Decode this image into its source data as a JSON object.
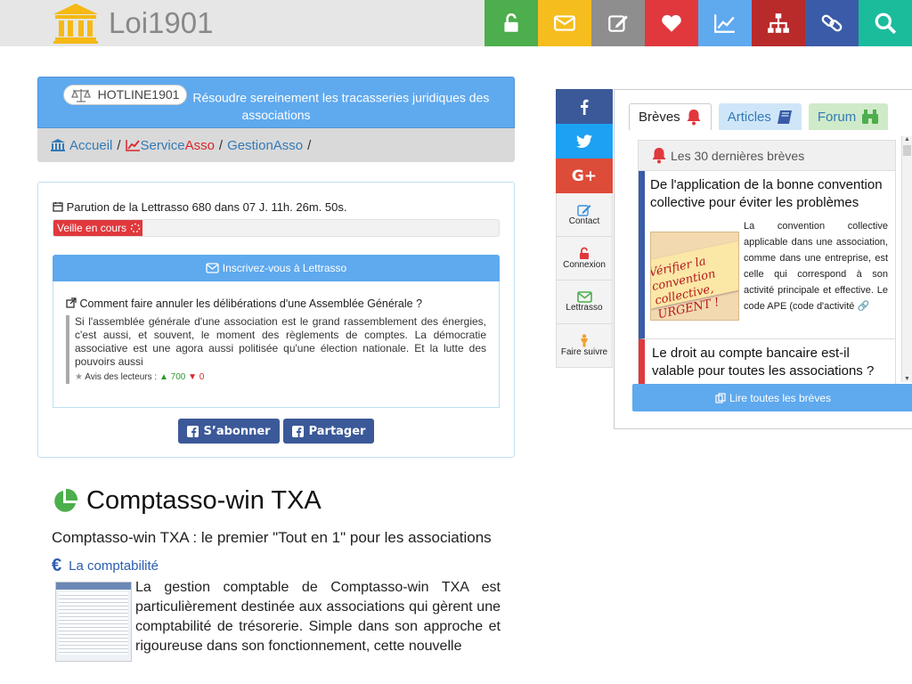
{
  "header": {
    "site_name": "Loi1901",
    "nav": [
      {
        "name": "login-nav-button",
        "icon": "unlock-icon",
        "color": "#4cae4c"
      },
      {
        "name": "mail-nav-button",
        "icon": "envelope-icon",
        "color": "#f5bd1e"
      },
      {
        "name": "edit-nav-button",
        "icon": "edit-icon",
        "color": "#8e8e8e"
      },
      {
        "name": "favorites-nav-button",
        "icon": "heart-icon",
        "color": "#e0383d"
      },
      {
        "name": "stats-nav-button",
        "icon": "chart-icon",
        "color": "#5fa9ee"
      },
      {
        "name": "sitemap-nav-button",
        "icon": "sitemap-icon",
        "color": "#b92a2a"
      },
      {
        "name": "links-nav-button",
        "icon": "link-icon",
        "color": "#3a5ba8"
      },
      {
        "name": "search-nav-button",
        "icon": "search-icon",
        "color": "#1abc9c"
      }
    ]
  },
  "hotline": {
    "badge": "HOTLINE1901",
    "text": "Résoudre sereinement les tracasseries juridiques des associations"
  },
  "breadcrumb": {
    "home": "Accueil",
    "sep": "/",
    "service_a": "Service",
    "service_b": "Asso",
    "gestion": "GestionAsso"
  },
  "lettrasso": {
    "parution": "Parution de la Lettrasso 680 dans 07 J. 11h. 26m. 50s.",
    "progress_label": "Veille en cours",
    "progress_fraction": 0.2,
    "subscribe": "Inscrivez-vous à Lettrasso",
    "article_title": "Comment faire annuler les délibérations d'une Assemblée Générale ?",
    "article_excerpt": "Si l'assemblée générale d'une association est le grand rassemblement des énergies, c'est aussi, et souvent, le moment des règlements de comptes. La démocratie associative est une agora aussi politisée qu'une élection nationale. Et la lutte des pouvoirs aussi",
    "avis_label": "Avis des lecteurs :",
    "likes": "700",
    "dislikes": "0",
    "sabonner": "S’abonner",
    "partager": "Partager"
  },
  "comptasso": {
    "title": "Comptasso-win TXA",
    "subtitle": "Comptasso-win TXA : le premier \"Tout en 1\" pour les associations",
    "section": "La comptabilité",
    "text": "La gestion comptable de Comptasso-win TXA est particulièrement destinée aux associations qui gèrent une comptabilité de trésorerie. Simple dans son approche et rigoureuse dans son fonctionnement, cette nouvelle"
  },
  "share": {
    "contact": "Contact",
    "connexion": "Connexion",
    "lettrasso": "Lettrasso",
    "follow": "Faire suivre"
  },
  "breves": {
    "tabs": [
      "Brèves",
      "Articles",
      "Forum"
    ],
    "header": "Les 30 dernières brèves",
    "item1_title": "De l'application de la bonne convention collective pour éviter les problèmes",
    "item1_text": "La convention collective applicable dans une association, comme dans une entreprise, est celle qui correspond à son activité principale et effective. Le code APE (code d'activité",
    "item1_img_text": "Vérifier la convention collective, URGENT !",
    "item2_title": "Le droit au compte bancaire est-il valable pour toutes les associations ?",
    "read_all": "Lire toutes les brèves"
  }
}
